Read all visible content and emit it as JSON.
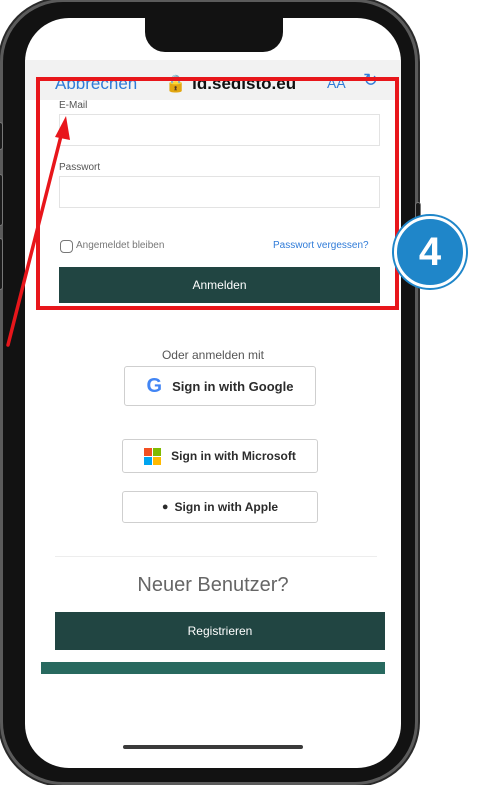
{
  "browser": {
    "cancel_label": "Abbrechen",
    "url": "id.sedisto.eu",
    "text_size_label": "AA",
    "lock_icon": "lock-icon",
    "reload_icon": "reload-icon"
  },
  "login_form": {
    "email_label": "E-Mail",
    "email_value": "",
    "password_label": "Passwort",
    "password_value": "",
    "remember_me_label": "Angemeldet bleiben",
    "remember_me_checked": false,
    "forgot_password_label": "Passwort vergessen?",
    "submit_label": "Anmelden"
  },
  "social_login": {
    "heading": "Oder anmelden mit",
    "providers": [
      {
        "label": "Sign in with Google",
        "icon": "google-icon"
      },
      {
        "label": "Sign in with Microsoft",
        "icon": "microsoft-icon"
      },
      {
        "label": "Sign in with Apple",
        "icon": "apple-icon"
      }
    ]
  },
  "register": {
    "heading": "Neuer Benutzer?",
    "button_label": "Registrieren"
  },
  "annotation": {
    "step_number": "4",
    "highlight_color": "#e8161b",
    "badge_color": "#1f86c9"
  },
  "colors": {
    "primary": "#214542",
    "link": "#2f7bd8",
    "footer": "#28695f",
    "google_blue": "#4285f4",
    "ms_red": "#f25022",
    "ms_green": "#7fba00",
    "ms_blue": "#00a4ef",
    "ms_yellow": "#ffb900"
  }
}
